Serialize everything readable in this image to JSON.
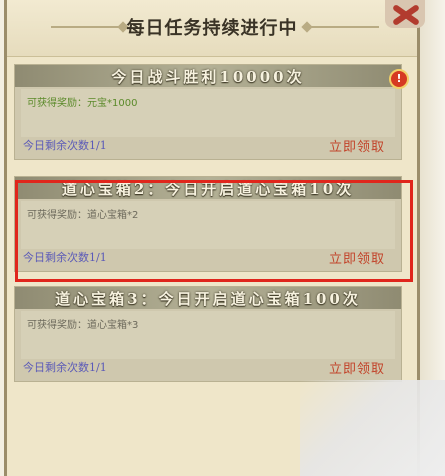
{
  "window": {
    "title": "每日任务持续进行中"
  },
  "tasks": [
    {
      "title": "今日战斗胜利10000次",
      "reward": "可获得奖励：元宝*1000",
      "remaining": "今日剩余次数1/1",
      "claim": "立即领取"
    },
    {
      "title": "道心宝箱2：今日开启道心宝箱10次",
      "reward": "可获得奖励：道心宝箱*2",
      "remaining": "今日剩余次数1/1",
      "claim": "立即领取"
    },
    {
      "title": "道心宝箱3：今日开启道心宝箱100次",
      "reward": "可获得奖励：道心宝箱*3",
      "remaining": "今日剩余次数1/1",
      "claim": "立即领取"
    }
  ],
  "alert": {
    "icon": "exclamation-icon",
    "glyph": "!"
  },
  "colors": {
    "highlight_border": "#e0261c",
    "claim_text": "#c2432a",
    "remaining_text": "#5b5ab8",
    "reward_text_first": "#5b8a2a"
  }
}
